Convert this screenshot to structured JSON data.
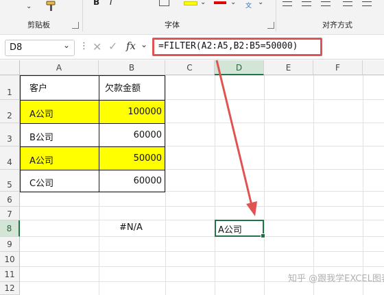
{
  "ribbon": {
    "clipboard_group_label": "剪贴板",
    "font_group_label": "字体",
    "alignment_group_label": "对齐方式",
    "bold_label": "B",
    "italic_label": "I",
    "wen_label": "文"
  },
  "formula_bar": {
    "name_box": "D8",
    "fx_label": "fx",
    "formula": "=FILTER(A2:A5,B2:B5=50000)"
  },
  "sheet": {
    "columns": [
      "A",
      "B",
      "C",
      "D",
      "E",
      "F"
    ],
    "rows": [
      "1",
      "2",
      "3",
      "4",
      "5",
      "6",
      "7",
      "8",
      "9",
      "10",
      "11",
      "12"
    ],
    "cells": {
      "A1": "客户",
      "B1": "欠款金额",
      "A2": "A公司",
      "B2": "100000",
      "A3": "B公司",
      "B3": "60000",
      "A4": "A公司",
      "B4": "50000",
      "A5": "C公司",
      "B5": "60000",
      "B8": "#N/A",
      "D8": "A公司"
    },
    "highlight_color": "#ffff00",
    "selection_color": "#217346"
  },
  "annotation": {
    "arrow_color": "#e05353"
  },
  "watermark": "知乎 @跟我学EXCEL图表"
}
